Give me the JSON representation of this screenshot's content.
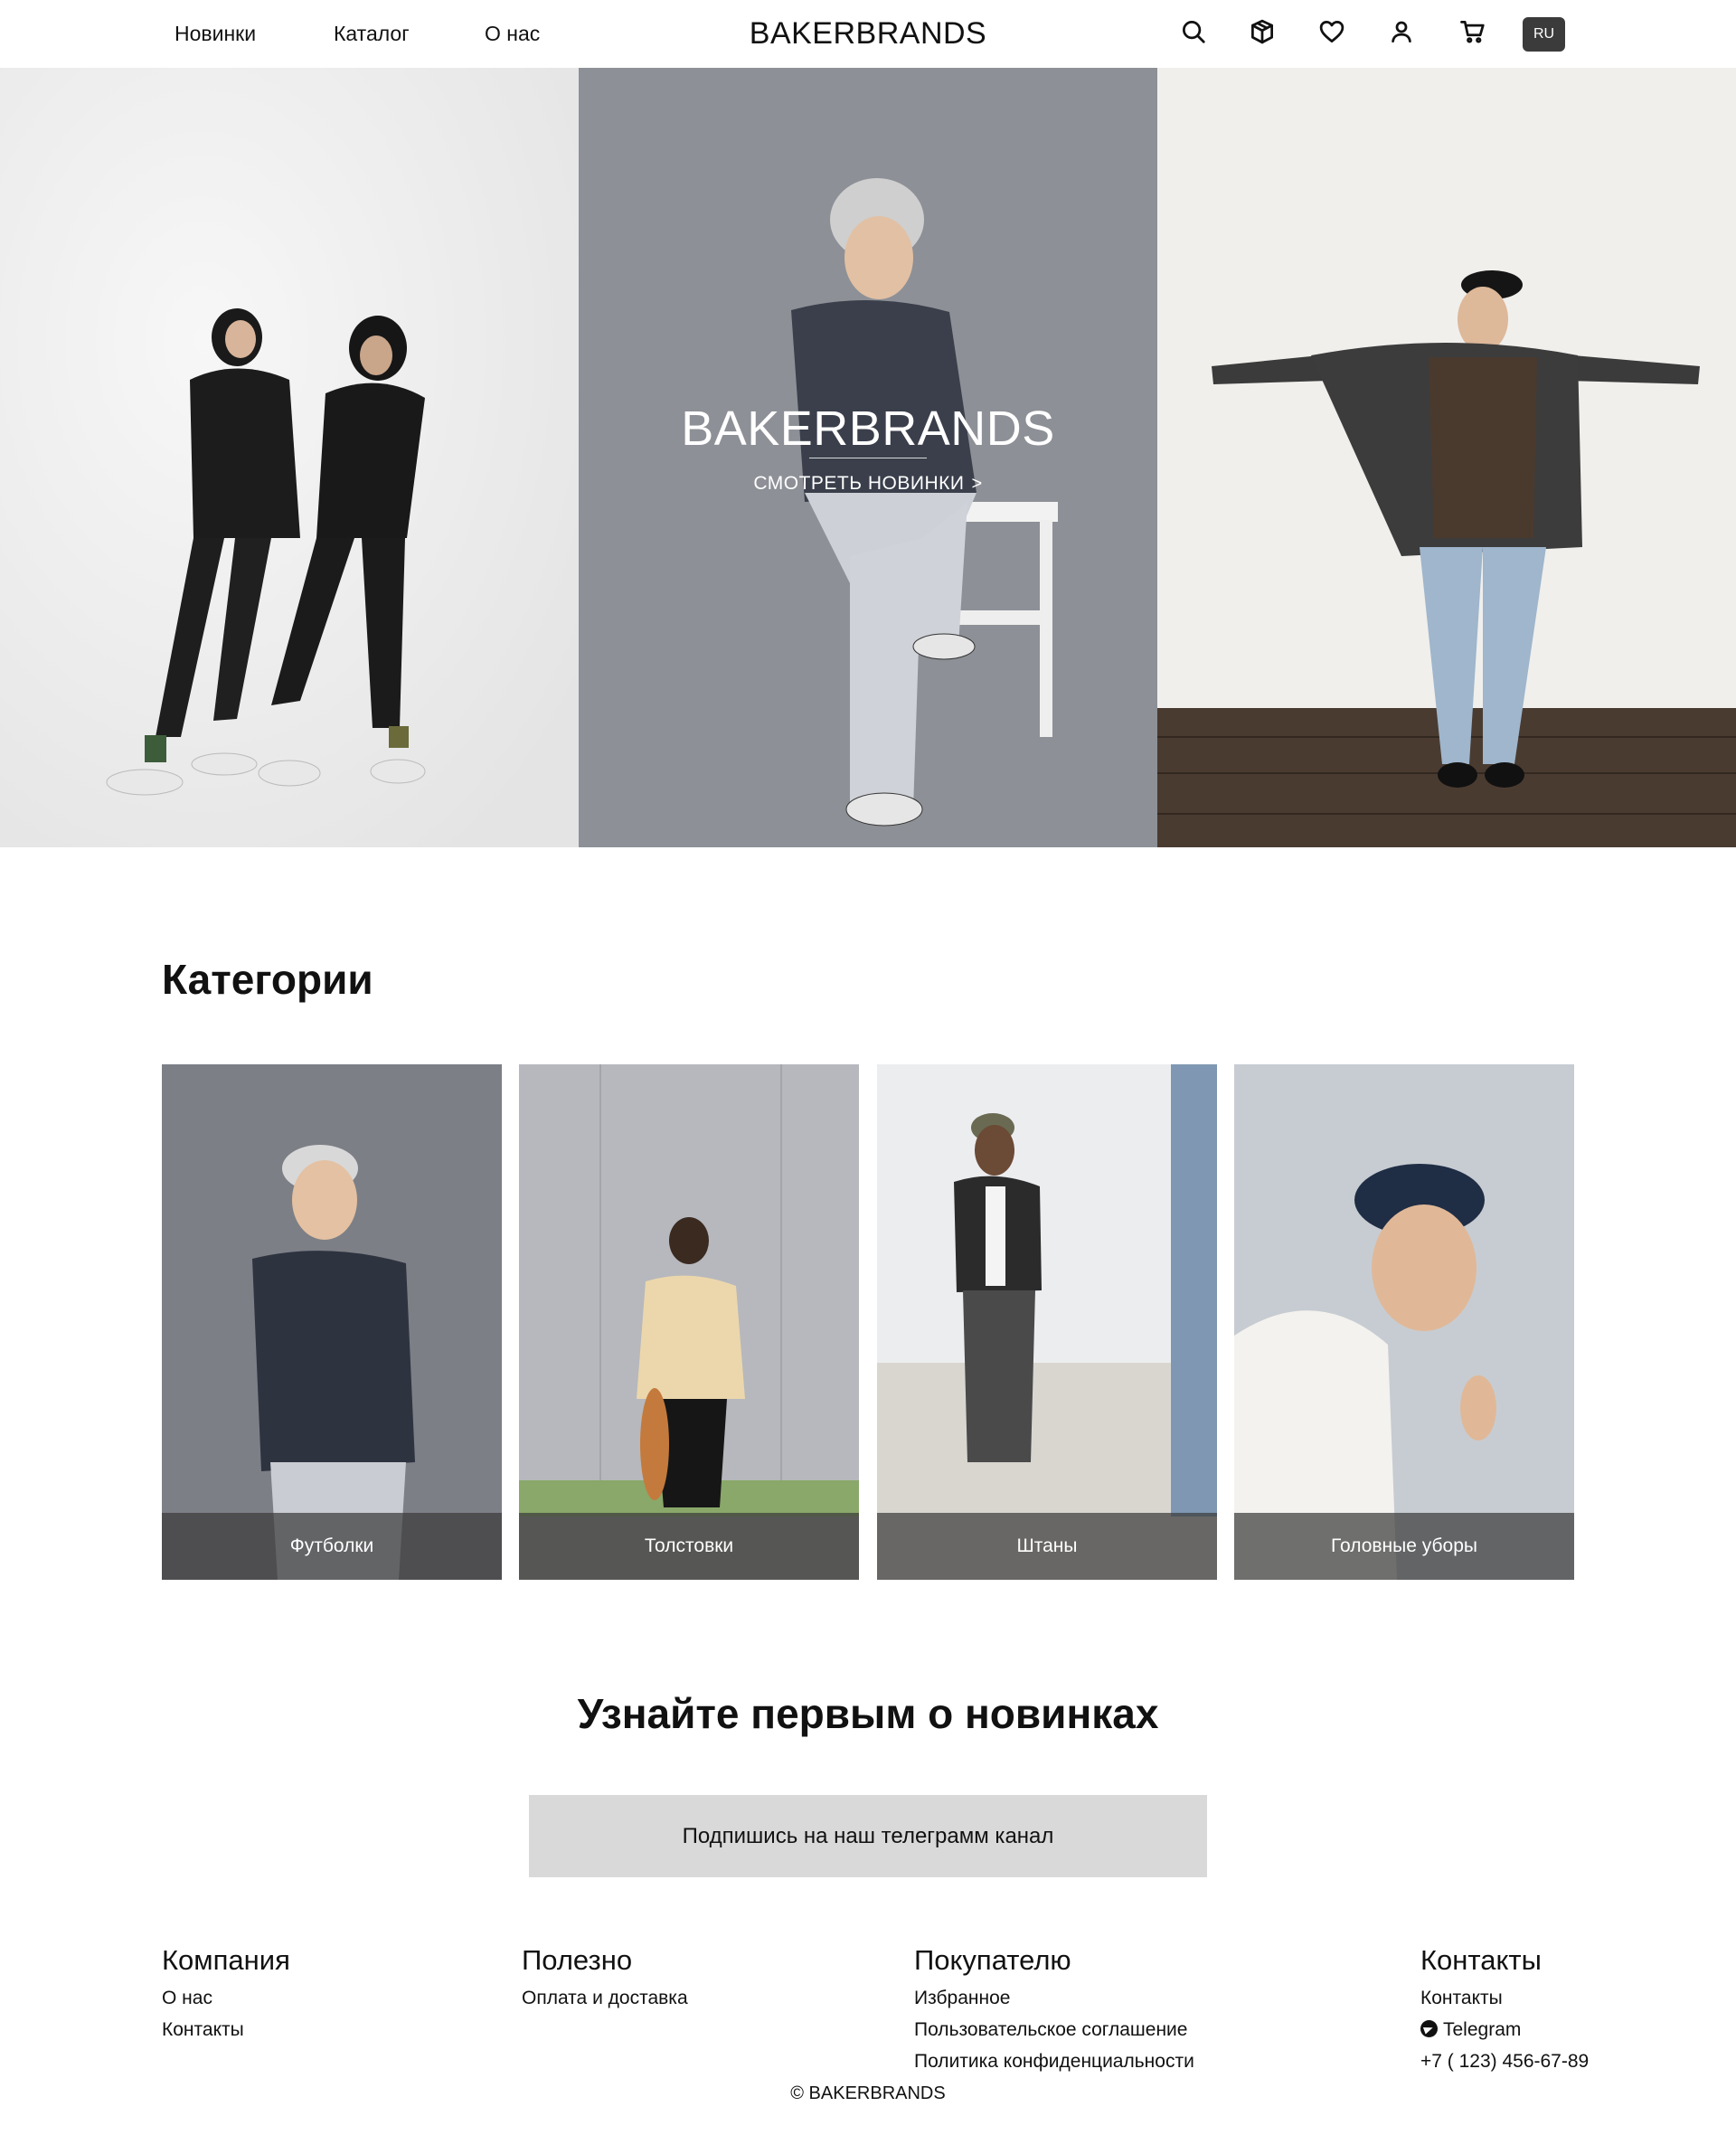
{
  "header": {
    "nav": [
      "Новинки",
      "Каталог",
      "О нас"
    ],
    "logo": "BAKERBRANDS",
    "lang": "RU",
    "icons": [
      "search-icon",
      "box-icon",
      "heart-icon",
      "user-icon",
      "cart-icon"
    ]
  },
  "hero": {
    "title": "BAKERBRANDS",
    "cta": "СМОТРЕТЬ НОВИНКИ",
    "cta_chevron": ">"
  },
  "categories": {
    "title": "Категории",
    "items": [
      {
        "label": "Футболки"
      },
      {
        "label": "Толстовки"
      },
      {
        "label": "Штаны"
      },
      {
        "label": "Головные уборы"
      }
    ]
  },
  "subscribe": {
    "title": "Узнайте первым о новинках",
    "button": "Подпишись на наш телеграмм канал"
  },
  "footer": {
    "company": {
      "title": "Компания",
      "links": [
        "О нас",
        "Контакты"
      ]
    },
    "useful": {
      "title": "Полезно",
      "links": [
        "Оплата и доставка"
      ]
    },
    "buyer": {
      "title": "Покупателю",
      "links": [
        "Избранное",
        "Пользовательское соглашение",
        "Политика конфиденциальности"
      ]
    },
    "contacts": {
      "title": "Контакты",
      "links": [
        "Контакты",
        "Telegram",
        "+7 ( 123) 456-67-89"
      ]
    },
    "copyright": "© BAKERBRANDS"
  },
  "colors": {
    "lang_badge": "#3b3b3b",
    "subscribe_button": "#d9d9d9",
    "category_label_bar": "#3c3c3c"
  }
}
